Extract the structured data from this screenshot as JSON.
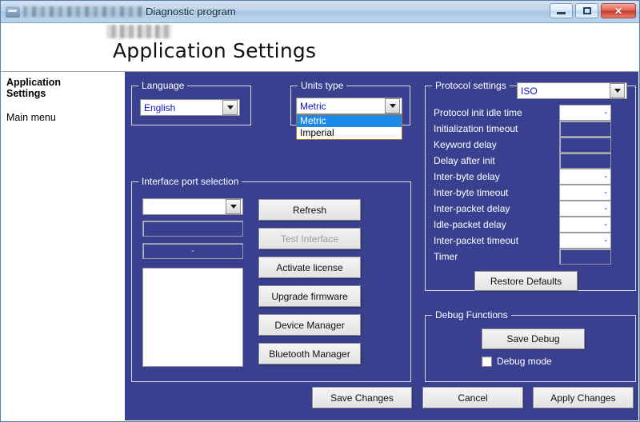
{
  "window": {
    "title_suffix": "Diagnostic program",
    "title_redacted": true,
    "buttons": {
      "minimize": "Minimize",
      "maximize": "Maximize",
      "close": "✕"
    }
  },
  "header": {
    "page_title": "Application Settings",
    "logo_redacted": true
  },
  "sidebar": {
    "title": "Application Settings",
    "items": [
      {
        "label": "Main menu"
      }
    ]
  },
  "language_group": {
    "legend": "Language",
    "combo_value": "English"
  },
  "units_group": {
    "legend": "Units type",
    "combo_value": "Metric",
    "options": [
      {
        "label": "Metric",
        "selected": true
      },
      {
        "label": "Imperial",
        "selected": false
      }
    ]
  },
  "interface_group": {
    "legend": "Interface port selection",
    "port_combo_value": "",
    "info_field_1": "",
    "info_field_2": "-",
    "listbox_value": "",
    "buttons": [
      {
        "label": "Refresh",
        "enabled": true
      },
      {
        "label": "Test Interface",
        "enabled": false
      },
      {
        "label": "Activate license",
        "enabled": true
      },
      {
        "label": "Upgrade firmware",
        "enabled": true
      },
      {
        "label": "Device Manager",
        "enabled": true
      },
      {
        "label": "Bluetooth Manager",
        "enabled": true
      }
    ]
  },
  "protocol_group": {
    "legend": "Protocol settings",
    "protocol_value": "ISO",
    "rows": [
      {
        "label": "Protocol init idle time",
        "value": "-",
        "enabled": true
      },
      {
        "label": "Initialization timeout",
        "value": "",
        "enabled": false
      },
      {
        "label": "Keyword delay",
        "value": "",
        "enabled": false
      },
      {
        "label": "Delay after init",
        "value": "",
        "enabled": false
      },
      {
        "label": "Inter-byte delay",
        "value": "-",
        "enabled": true
      },
      {
        "label": "Inter-byte timeout",
        "value": "-",
        "enabled": true
      },
      {
        "label": "Inter-packet delay",
        "value": "-",
        "enabled": true
      },
      {
        "label": "Idle-packet delay",
        "value": "-",
        "enabled": true
      },
      {
        "label": "Inter-packet timeout",
        "value": "-",
        "enabled": true
      },
      {
        "label": "Timer",
        "value": "",
        "enabled": false
      }
    ],
    "restore_button": "Restore Defaults"
  },
  "debug_group": {
    "legend": "Debug Functions",
    "save_button": "Save Debug",
    "checkbox_label": "Debug mode",
    "checkbox_checked": false
  },
  "footer": {
    "save_changes": "Save Changes",
    "cancel": "Cancel",
    "apply_changes": "Apply Changes"
  },
  "colors": {
    "panel_background": "#3a4090",
    "group_border": "#d7d9e8",
    "combo_text": "#1414cc",
    "dropdown_highlight": "#1e8ae8",
    "dropdown_border": "#b5702a",
    "title_bar": "#bed4ea",
    "close_button": "#c93828"
  }
}
